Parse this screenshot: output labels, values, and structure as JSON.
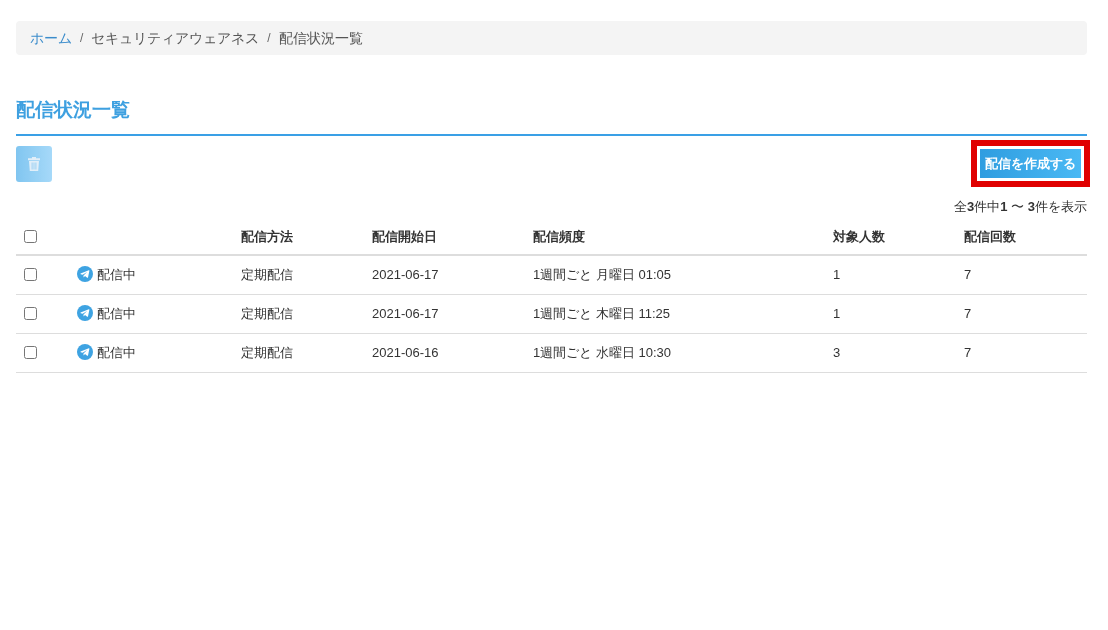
{
  "breadcrumb": [
    {
      "kind": "link",
      "label": "ホーム"
    },
    {
      "kind": "separator",
      "label": "/"
    },
    {
      "kind": "text",
      "label": "セキュリティアウェアネス"
    },
    {
      "kind": "separator",
      "label": "/"
    },
    {
      "kind": "text",
      "label": "配信状況一覧"
    }
  ],
  "page_title": "配信状況一覧",
  "toolbar": {
    "delete_button": {
      "disabled": true
    },
    "create_button": {
      "label": "配信を作成する",
      "highlighted": true
    }
  },
  "result_summary": "全**3**件中**1** 〜 **3**件を表示",
  "table": {
    "select_all": {
      "checked": false
    },
    "columns": [
      {
        "label": "配信方法"
      },
      {
        "label": "配信開始日"
      },
      {
        "label": "配信頻度"
      },
      {
        "label": "対象人数"
      },
      {
        "label": "配信回数"
      }
    ],
    "rows": [
      {
        "checked": false,
        "status": "配信中",
        "method": "定期配信",
        "start_date": "2021-06-17",
        "frequency": "1週間ごと 月曜日 01:05",
        "recipients": "1",
        "deliveries": "7"
      },
      {
        "checked": false,
        "status": "配信中",
        "method": "定期配信",
        "start_date": "2021-06-17",
        "frequency": "1週間ごと 木曜日 11:25",
        "recipients": "1",
        "deliveries": "7"
      },
      {
        "checked": false,
        "status": "配信中",
        "method": "定期配信",
        "start_date": "2021-06-16",
        "frequency": "1週間ごと 水曜日 10:30",
        "recipients": "3",
        "deliveries": "7"
      }
    ]
  }
}
